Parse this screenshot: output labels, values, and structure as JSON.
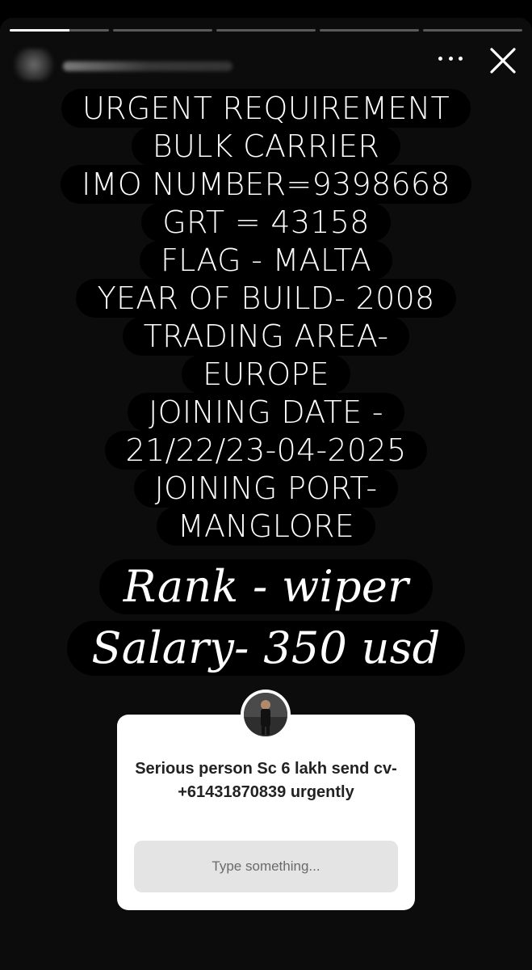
{
  "story": {
    "progress_segments": [
      {
        "state": "active",
        "filled": 0.6
      },
      {
        "state": "upcoming",
        "filled": 0
      },
      {
        "state": "upcoming",
        "filled": 0
      },
      {
        "state": "upcoming",
        "filled": 0
      },
      {
        "state": "upcoming",
        "filled": 0
      }
    ],
    "header": {
      "username": "",
      "more_icon": "more-horizontal-icon",
      "close_icon": "close-icon"
    },
    "lines": [
      "URGENT REQUIREMENT",
      "BULK CARRIER",
      "IMO NUMBER=9398668",
      "GRT = 43158",
      "FLAG - MALTA",
      "YEAR OF BUILD- 2008",
      "TRADING AREA-",
      "EUROPE",
      "JOINING DATE -",
      "21/22/23-04-2025",
      "JOINING PORT-",
      "MANGLORE"
    ],
    "highlight_lines": [
      "Rank - wiper",
      "Salary- 350 usd"
    ]
  },
  "question_sticker": {
    "question": "Serious person Sc 6 lakh send cv- +61431870839 urgently",
    "input_placeholder": "Type something..."
  },
  "colors": {
    "background": "#0c0c0c",
    "text_pill": "#000000",
    "sticker_bg": "#ffffff",
    "sticker_input_bg": "#e4e4e4"
  }
}
